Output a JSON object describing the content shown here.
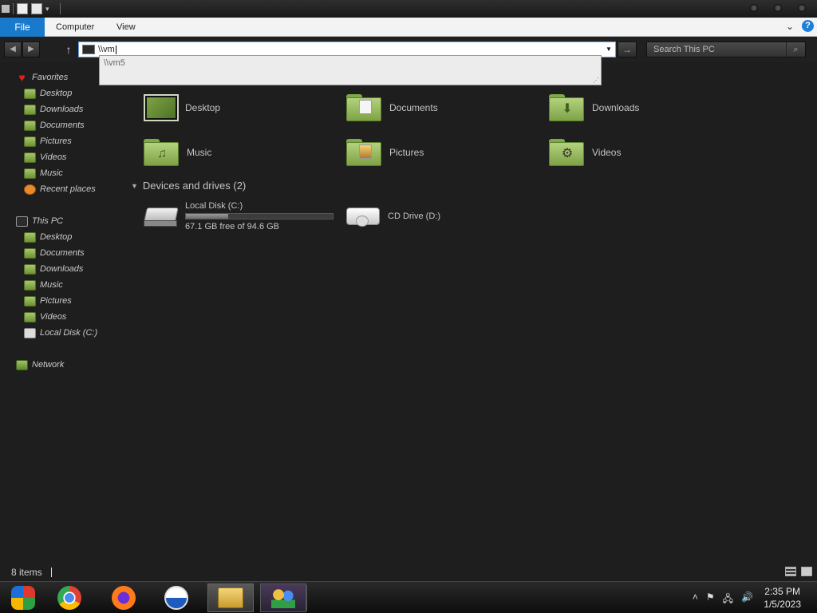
{
  "ribbon": {
    "tabs": [
      {
        "label": "File"
      },
      {
        "label": "Computer"
      },
      {
        "label": "View"
      }
    ],
    "help_label": "?"
  },
  "address": {
    "value": "\\\\vm",
    "suggestions": [
      "\\\\vm5"
    ]
  },
  "search": {
    "placeholder": "Search This PC"
  },
  "sidebar": {
    "favorites": {
      "label": "Favorites",
      "items": [
        {
          "label": "Desktop"
        },
        {
          "label": "Downloads"
        },
        {
          "label": "Documents"
        },
        {
          "label": "Pictures"
        },
        {
          "label": "Videos"
        },
        {
          "label": "Music"
        },
        {
          "label": "Recent places"
        }
      ]
    },
    "thispc": {
      "label": "This PC",
      "items": [
        {
          "label": "Desktop"
        },
        {
          "label": "Documents"
        },
        {
          "label": "Downloads"
        },
        {
          "label": "Music"
        },
        {
          "label": "Pictures"
        },
        {
          "label": "Videos"
        },
        {
          "label": "Local Disk (C:)"
        }
      ]
    },
    "network": {
      "label": "Network"
    }
  },
  "folders": [
    {
      "label": "Desktop"
    },
    {
      "label": "Documents"
    },
    {
      "label": "Downloads"
    },
    {
      "label": "Music"
    },
    {
      "label": "Pictures"
    },
    {
      "label": "Videos"
    }
  ],
  "devices": {
    "header": "Devices and drives (2)",
    "local_disk": {
      "label": "Local Disk (C:)",
      "free_text": "67.1 GB free of 94.6 GB",
      "used_fraction": 0.29
    },
    "cd_drive": {
      "label": "CD Drive (D:)"
    }
  },
  "status": {
    "items": "8 items"
  },
  "taskbar": {
    "time": "2:35 PM",
    "date": "1/5/2023"
  },
  "colors": {
    "accent": "#1979ca",
    "folder_green": "#7ea246"
  }
}
